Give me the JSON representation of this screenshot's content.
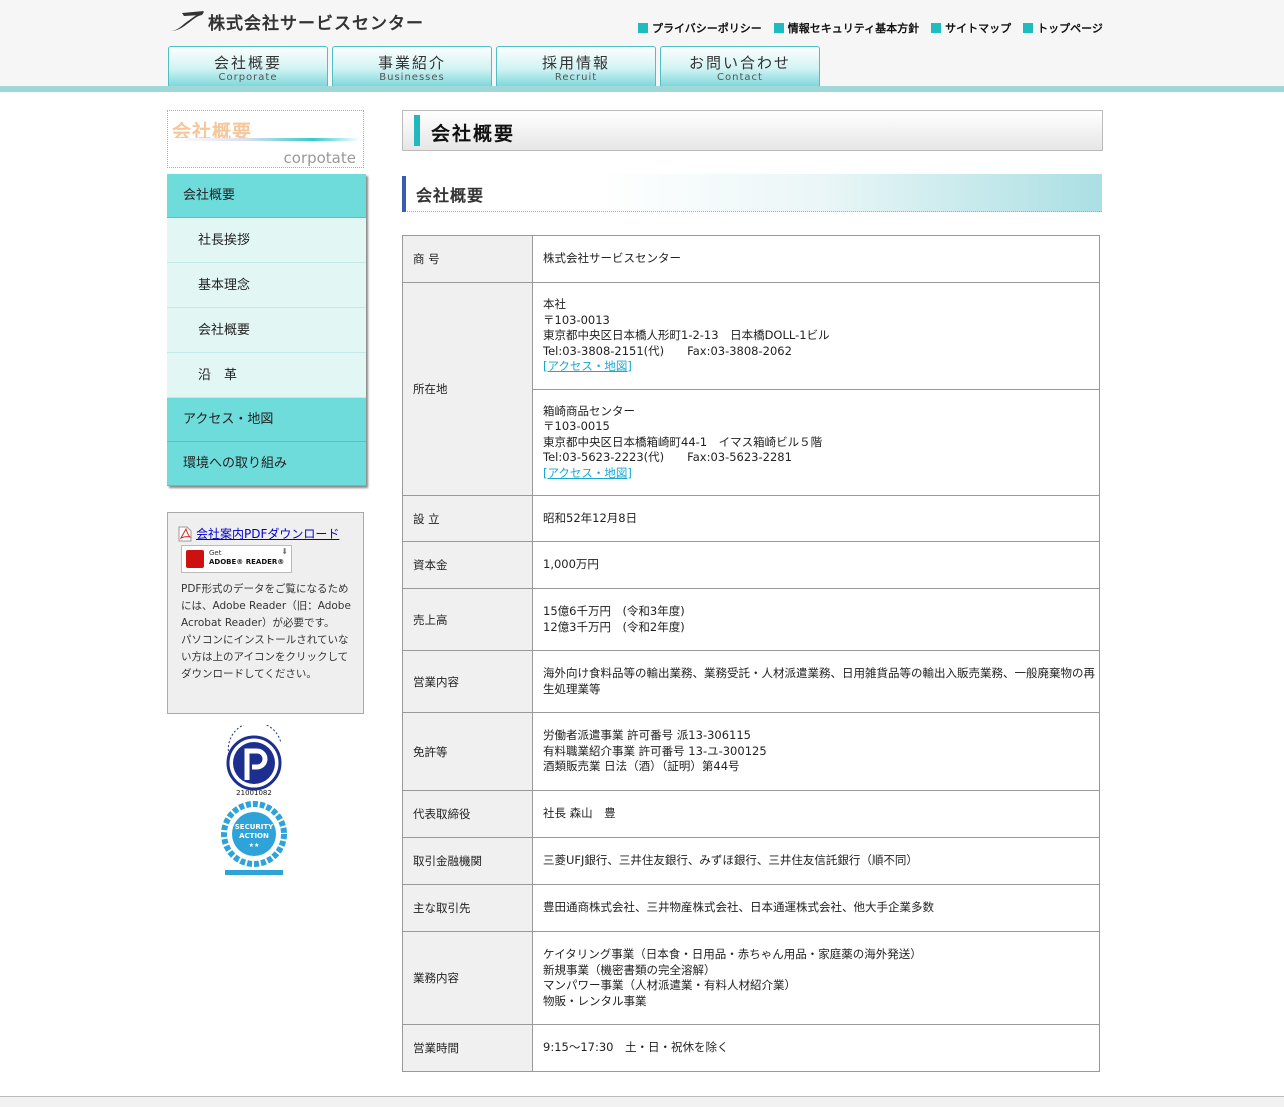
{
  "header": {
    "company_name": "株式会社サービスセンター",
    "util_links": [
      "プライバシーポリシー",
      "情報セキュリティ基本方針",
      "サイトマップ",
      "トップページ"
    ],
    "nav": [
      {
        "ja": "会社概要",
        "en": "Corporate"
      },
      {
        "ja": "事業紹介",
        "en": "Businesses"
      },
      {
        "ja": "採用情報",
        "en": "Recruit"
      },
      {
        "ja": "お問い合わせ",
        "en": "Contact"
      }
    ],
    "accent_color": "#1dbcbf"
  },
  "sidebar": {
    "head_ja": "会社概要",
    "head_en": "corpotate",
    "menu": [
      {
        "label": "会社概要",
        "type": "main"
      },
      {
        "label": "社長挨拶",
        "type": "sub"
      },
      {
        "label": "基本理念",
        "type": "sub"
      },
      {
        "label": "会社概要",
        "type": "sub"
      },
      {
        "label": "沿　革",
        "type": "sub"
      },
      {
        "label": "アクセス・地図",
        "type": "main"
      },
      {
        "label": "環境への取り組み",
        "type": "main"
      }
    ],
    "pdf_link": "会社案内PDFダウンロード",
    "adobe_get": "Get",
    "adobe_reader": "ADOBE® READER®",
    "pdf_note": "PDF形式のデータをご覧になるためには、Adobe Reader（旧：Adobe Acrobat Reader）が必要です。\nパソコンにインストールされていない方は上のアイコンをクリックしてダウンロードしてください。",
    "privacy_number": "21001082"
  },
  "main": {
    "page_title": "会社概要",
    "section_title": "会社概要",
    "rows": {
      "name_label": "商 号",
      "name_value": "株式会社サービスセンター",
      "address_label": "所在地",
      "hq": {
        "name": "本社",
        "zip": "〒103-0013",
        "address": "東京都中央区日本橋人形町1-2-13　日本橋DOLL-1ビル",
        "tel": "Tel:03-3808-2151(代)　　Fax:03-3808-2062",
        "map": "[アクセス・地図]"
      },
      "branch": {
        "name": "箱崎商品センター",
        "zip": "〒103-0015",
        "address": "東京都中央区日本橋箱崎町44-1　イマス箱崎ビル５階",
        "tel": "Tel:03-5623-2223(代)　　Fax:03-5623-2281",
        "map": "[アクセス・地図]"
      },
      "founded_label": "設 立",
      "founded_value": "昭和52年12月8日",
      "capital_label": "資本金",
      "capital_value": "1,000万円",
      "sales_label": "売上高",
      "sales_value_1": "15億6千万円　(令和3年度)",
      "sales_value_2": "12億3千万円　(令和2年度)",
      "ops_label": "営業内容",
      "ops_value": "海外向け食料品等の輸出業務、業務受託・人材派遣業務、日用雑貨品等の輸出入販売業務、一般廃棄物の再生処理業等",
      "license_label": "免許等",
      "license_1": "労働者派遣事業 許可番号 派13-306115",
      "license_2": "有料職業紹介事業 許可番号 13-ユ-300125",
      "license_3": "酒類販売業 日法（酒）（証明）第44号",
      "ceo_label": "代表取締役",
      "ceo_value": "社長 森山　豊",
      "bank_label": "取引金融機関",
      "bank_value": "三菱UFJ銀行、三井住友銀行、みずほ銀行、三井住友信託銀行（順不同）",
      "client_label": "主な取引先",
      "client_value": "豊田通商株式会社、三井物産株式会社、日本通運株式会社、他大手企業多数",
      "business_label": "業務内容",
      "business_1": "ケイタリング事業（日本食・日用品・赤ちゃん用品・家庭薬の海外発送）",
      "business_2": "新規事業（機密書類の完全溶解）",
      "business_3": "マンパワー事業（人材派遣業・有料人材紹介業）",
      "business_4": "物販・レンタル事業",
      "hours_label": "営業時間",
      "hours_value": "9:15〜17:30　土・日・祝休を除く"
    }
  }
}
